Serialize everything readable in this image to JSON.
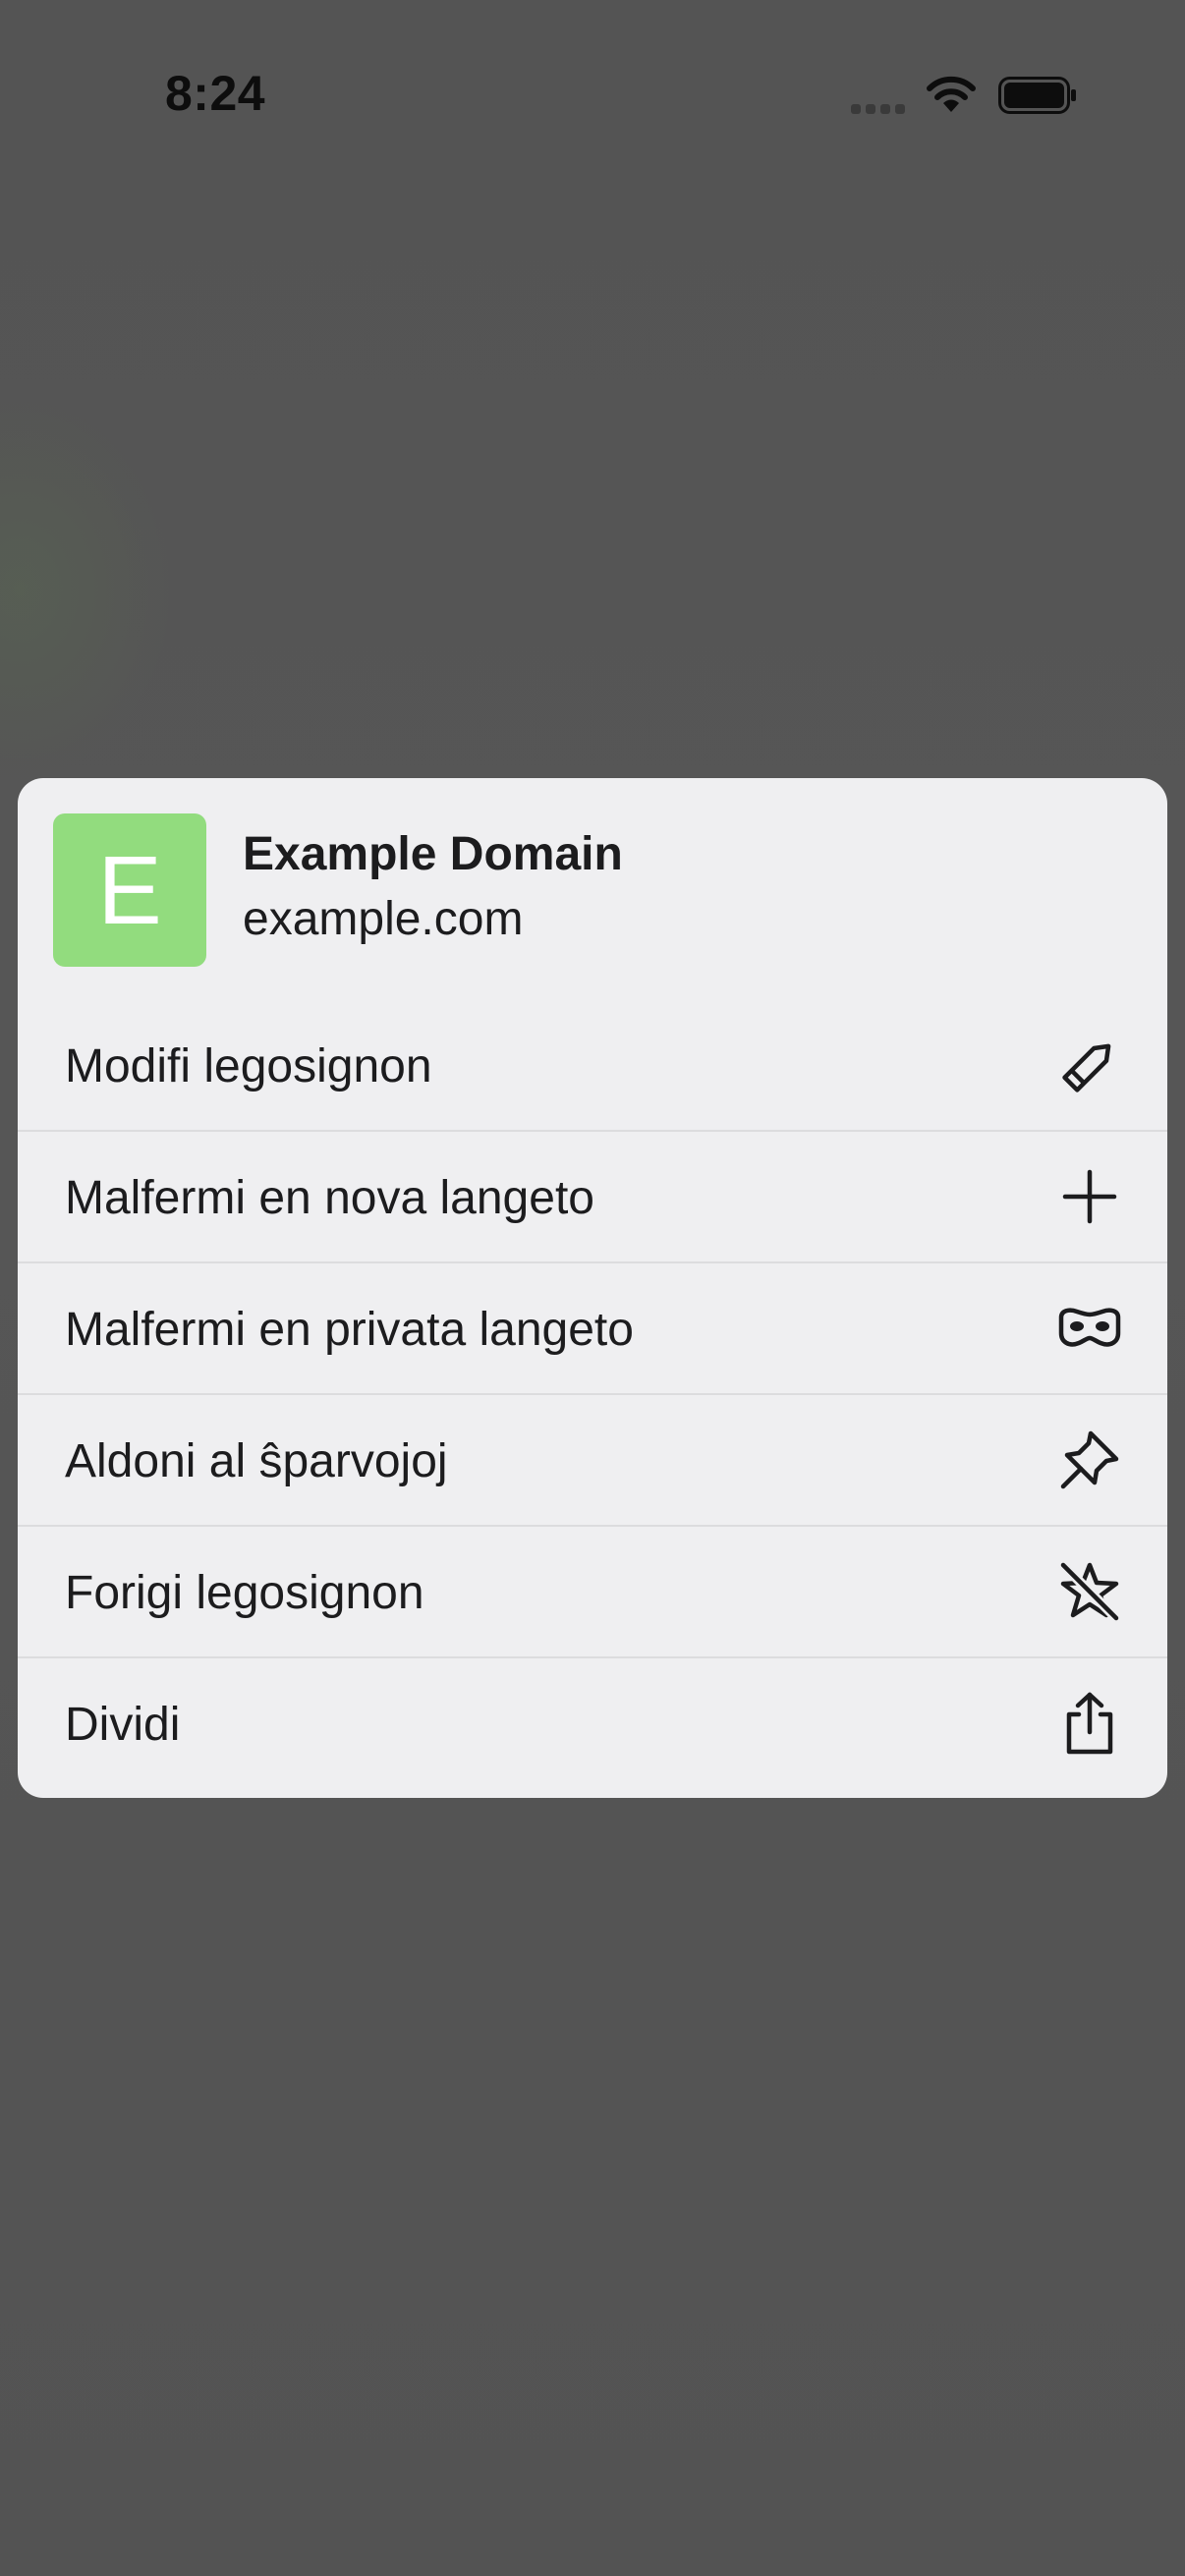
{
  "status_bar": {
    "time": "8:24"
  },
  "context_menu": {
    "header": {
      "favicon_letter": "E",
      "favicon_color": "#92dc7e",
      "title": "Example Domain",
      "url": "example.com"
    },
    "items": [
      {
        "label": "Modifi legosignon",
        "icon": "pencil-icon"
      },
      {
        "label": "Malfermi en nova langeto",
        "icon": "plus-icon"
      },
      {
        "label": "Malfermi en privata langeto",
        "icon": "private-mask-icon"
      },
      {
        "label": "Aldoni al ŝparvojoj",
        "icon": "pin-icon"
      },
      {
        "label": "Forigi legosignon",
        "icon": "remove-star-icon"
      },
      {
        "label": "Dividi",
        "icon": "share-icon"
      }
    ]
  },
  "colors": {
    "backdrop": "#535353",
    "menu_background": "#efeff1",
    "text": "#1c1c1e",
    "separator": "#dcdcde"
  }
}
